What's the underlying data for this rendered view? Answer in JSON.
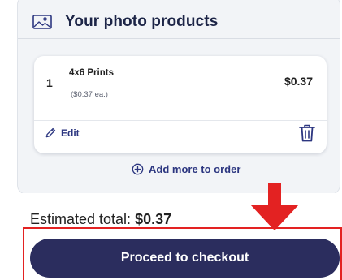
{
  "header": {
    "title": "Your photo products",
    "icon": "photo-frame-icon"
  },
  "order_item": {
    "quantity": "1",
    "name": "4x6 Prints",
    "unit_price": "($0.37 ea.)",
    "price": "$0.37",
    "edit_label": "Edit",
    "edit_icon": "pencil-icon",
    "delete_icon": "trash-icon"
  },
  "add_more": {
    "label": "Add more to order",
    "icon": "plus-circle-icon"
  },
  "summary": {
    "total_label": "Estimated total:",
    "total_value": "$0.37"
  },
  "checkout": {
    "label": "Proceed to checkout"
  },
  "annotation": {
    "arrow_color": "#e32222",
    "frame_color": "#e32222",
    "icon": "down-arrow-icon"
  },
  "colors": {
    "primary": "#2b2d5e",
    "link": "#2c3680",
    "card_background": "#f2f4f7"
  }
}
